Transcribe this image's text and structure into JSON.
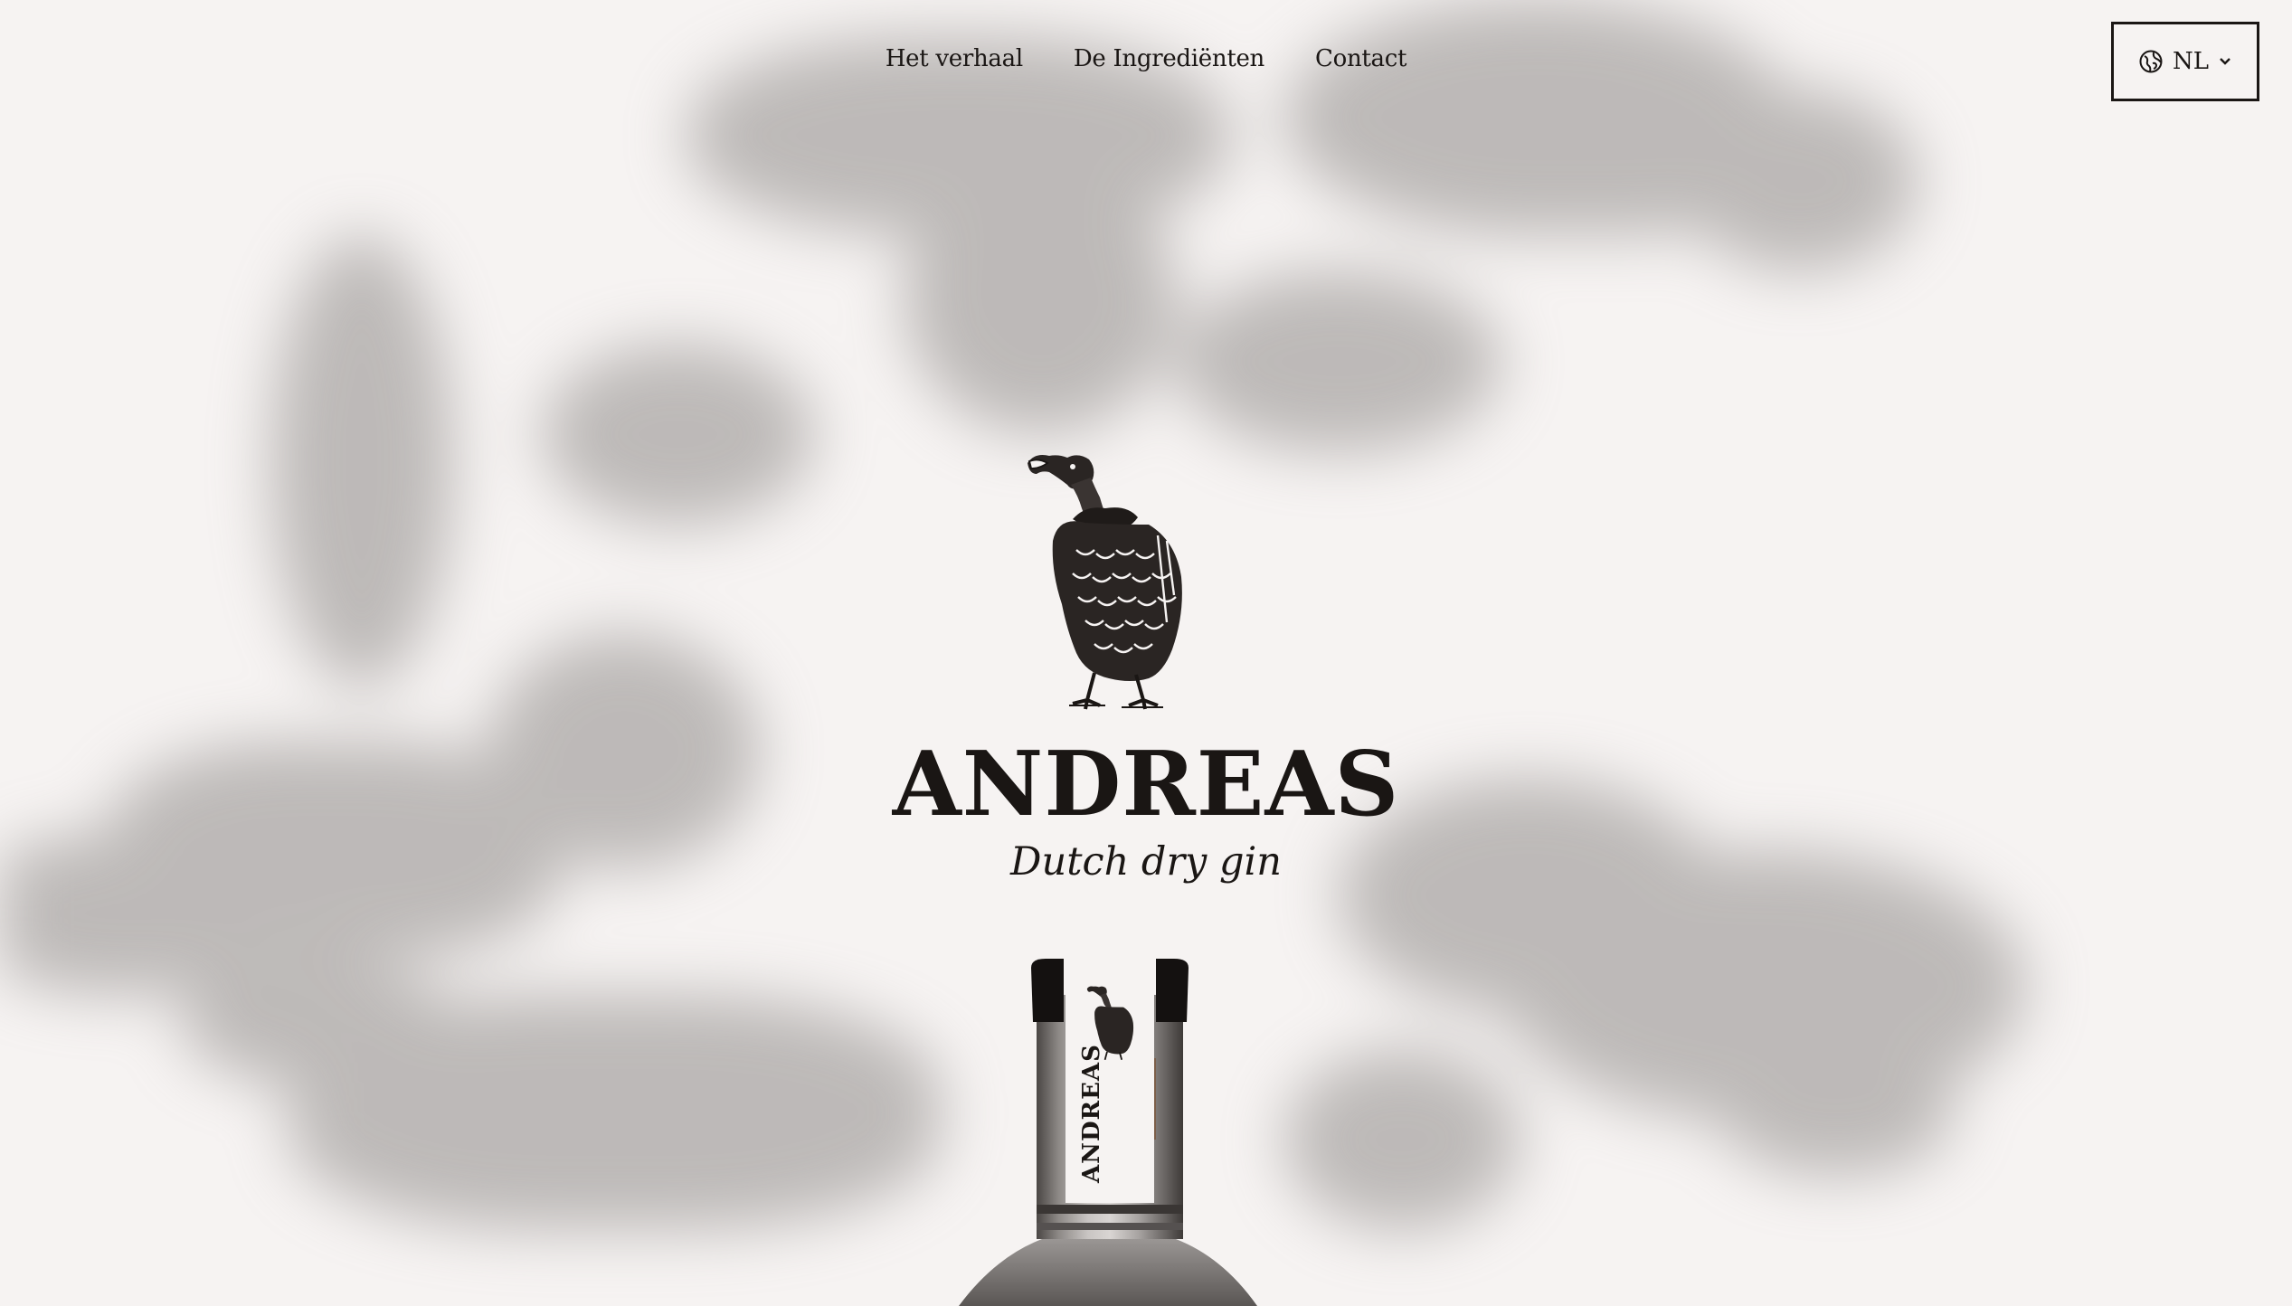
{
  "nav": {
    "items": [
      {
        "label": "Het verhaal"
      },
      {
        "label": "De Ingrediënten"
      },
      {
        "label": "Contact"
      }
    ]
  },
  "language": {
    "current": "NL",
    "icon": "globe-icon",
    "chevron": "chevron-down-icon"
  },
  "hero": {
    "logo_icon": "vulture-illustration",
    "brand_name": "ANDREAS",
    "tagline": "Dutch dry gin"
  },
  "bottle": {
    "label_text": "ANDREAS"
  },
  "colors": {
    "background": "#f6f3f2",
    "text": "#1a1614",
    "shadow": "#8f8b89"
  }
}
